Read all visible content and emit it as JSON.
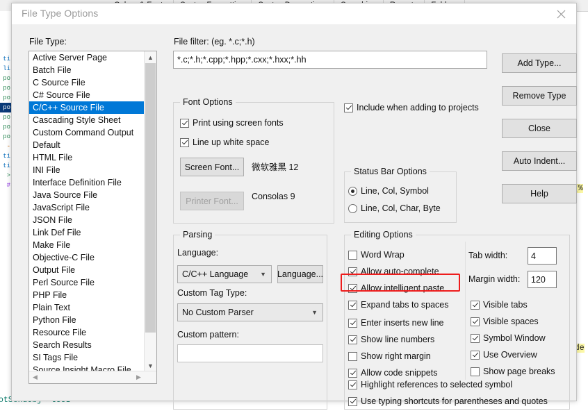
{
  "background": {
    "tabs": [
      "Colors & Fonts",
      "Syntax Formatting",
      "Syntax Decorations",
      "Searching",
      "Remote",
      "Folders"
    ],
    "code_right_top": "r[%",
    "code_right_bottom": "ode",
    "code_bottom_left": "otSendObj->tUUI",
    "gutter_numbers": [
      "ti",
      "li",
      "",
      "",
      "",
      "",
      "",
      "",
      "",
      "",
      "",
      "",
      "",
      "",
      "",
      ""
    ]
  },
  "dialog": {
    "title": "File Type Options",
    "close_icon": "close-icon"
  },
  "file_type": {
    "label": "File Type:",
    "items": [
      "Active Server Page",
      "Batch File",
      "C Source File",
      "C# Source File",
      "C/C++ Source File",
      "Cascading Style Sheet",
      "Custom Command Output",
      "Default",
      "HTML File",
      "INI File",
      "Interface Definition File",
      "Java Source File",
      "JavaScript File",
      "JSON File",
      "Link Def File",
      "Make File",
      "Objective-C File",
      "Output File",
      "Perl Source File",
      "PHP File",
      "Plain Text",
      "Python File",
      "Resource File",
      "Search Results",
      "SI Tags File",
      "Source Insight Macro File"
    ],
    "selected": "C/C++ Source File",
    "selected_index": 4,
    "selected_color": "#0078d7"
  },
  "file_filter": {
    "label": "File filter: (eg. *.c;*.h)",
    "value": "*.c;*.h;*.cpp;*.hpp;*.cxx;*.hxx;*.hh",
    "placeholder": "*.c;*.h"
  },
  "font_options": {
    "title": "Font Options",
    "print_using_screen_fonts": {
      "label": "Print using screen fonts",
      "checked": true
    },
    "line_up_white_space": {
      "label": "Line up white space",
      "checked": true
    },
    "screen_font_button": "Screen Font...",
    "screen_font_name": "微软雅黑 12",
    "printer_font_button": "Printer Font...",
    "printer_font_name": "Consolas 9",
    "printer_font_disabled": true
  },
  "include_when_adding": {
    "label": "Include when adding to projects",
    "checked": true
  },
  "status_bar_options": {
    "title": "Status Bar Options",
    "options": [
      {
        "label": "Line, Col, Symbol",
        "selected": true
      },
      {
        "label": "Line, Col, Char, Byte",
        "selected": false
      }
    ]
  },
  "parsing": {
    "title": "Parsing",
    "language_label": "Language:",
    "language_value": "C/C++ Language",
    "language_button": "Language...",
    "custom_tag_type_label": "Custom Tag Type:",
    "custom_tag_type_value": "No Custom Parser",
    "custom_pattern_label": "Custom pattern:",
    "custom_pattern_value": "",
    "custom_pattern_placeholder": ""
  },
  "editing_options": {
    "title": "Editing Options",
    "left_column": [
      {
        "label": "Word Wrap",
        "checked": false
      },
      {
        "label": "Allow auto-complete",
        "checked": true
      },
      {
        "label": "Allow intelligent paste",
        "checked": true
      },
      {
        "label": "Expand tabs to spaces",
        "checked": true,
        "highlighted": true
      },
      {
        "label": "Enter inserts new line",
        "checked": true
      },
      {
        "label": "Show line numbers",
        "checked": true
      },
      {
        "label": "Show right margin",
        "checked": false
      },
      {
        "label": "Allow code snippets",
        "checked": true
      }
    ],
    "full_width": [
      {
        "label": "Highlight references to selected symbol",
        "checked": true
      },
      {
        "label": "Use typing shortcuts for parentheses and quotes",
        "checked": true
      }
    ],
    "tab_width_label": "Tab width:",
    "tab_width_value": "4",
    "margin_width_label": "Margin width:",
    "margin_width_value": "120",
    "right_column": [
      {
        "label": "Visible tabs",
        "checked": true
      },
      {
        "label": "Visible spaces",
        "checked": true
      },
      {
        "label": "Symbol Window",
        "checked": true
      },
      {
        "label": "Use Overview",
        "checked": true
      },
      {
        "label": "Show page breaks",
        "checked": false
      }
    ]
  },
  "buttons": {
    "add_type": "Add Type...",
    "remove_type": "Remove Type",
    "close": "Close",
    "auto_indent": "Auto Indent...",
    "help": "Help"
  },
  "colors": {
    "highlight_border": "#ee1c1c",
    "dialog_bg": "#f0f0f0",
    "selection": "#0078d7"
  }
}
